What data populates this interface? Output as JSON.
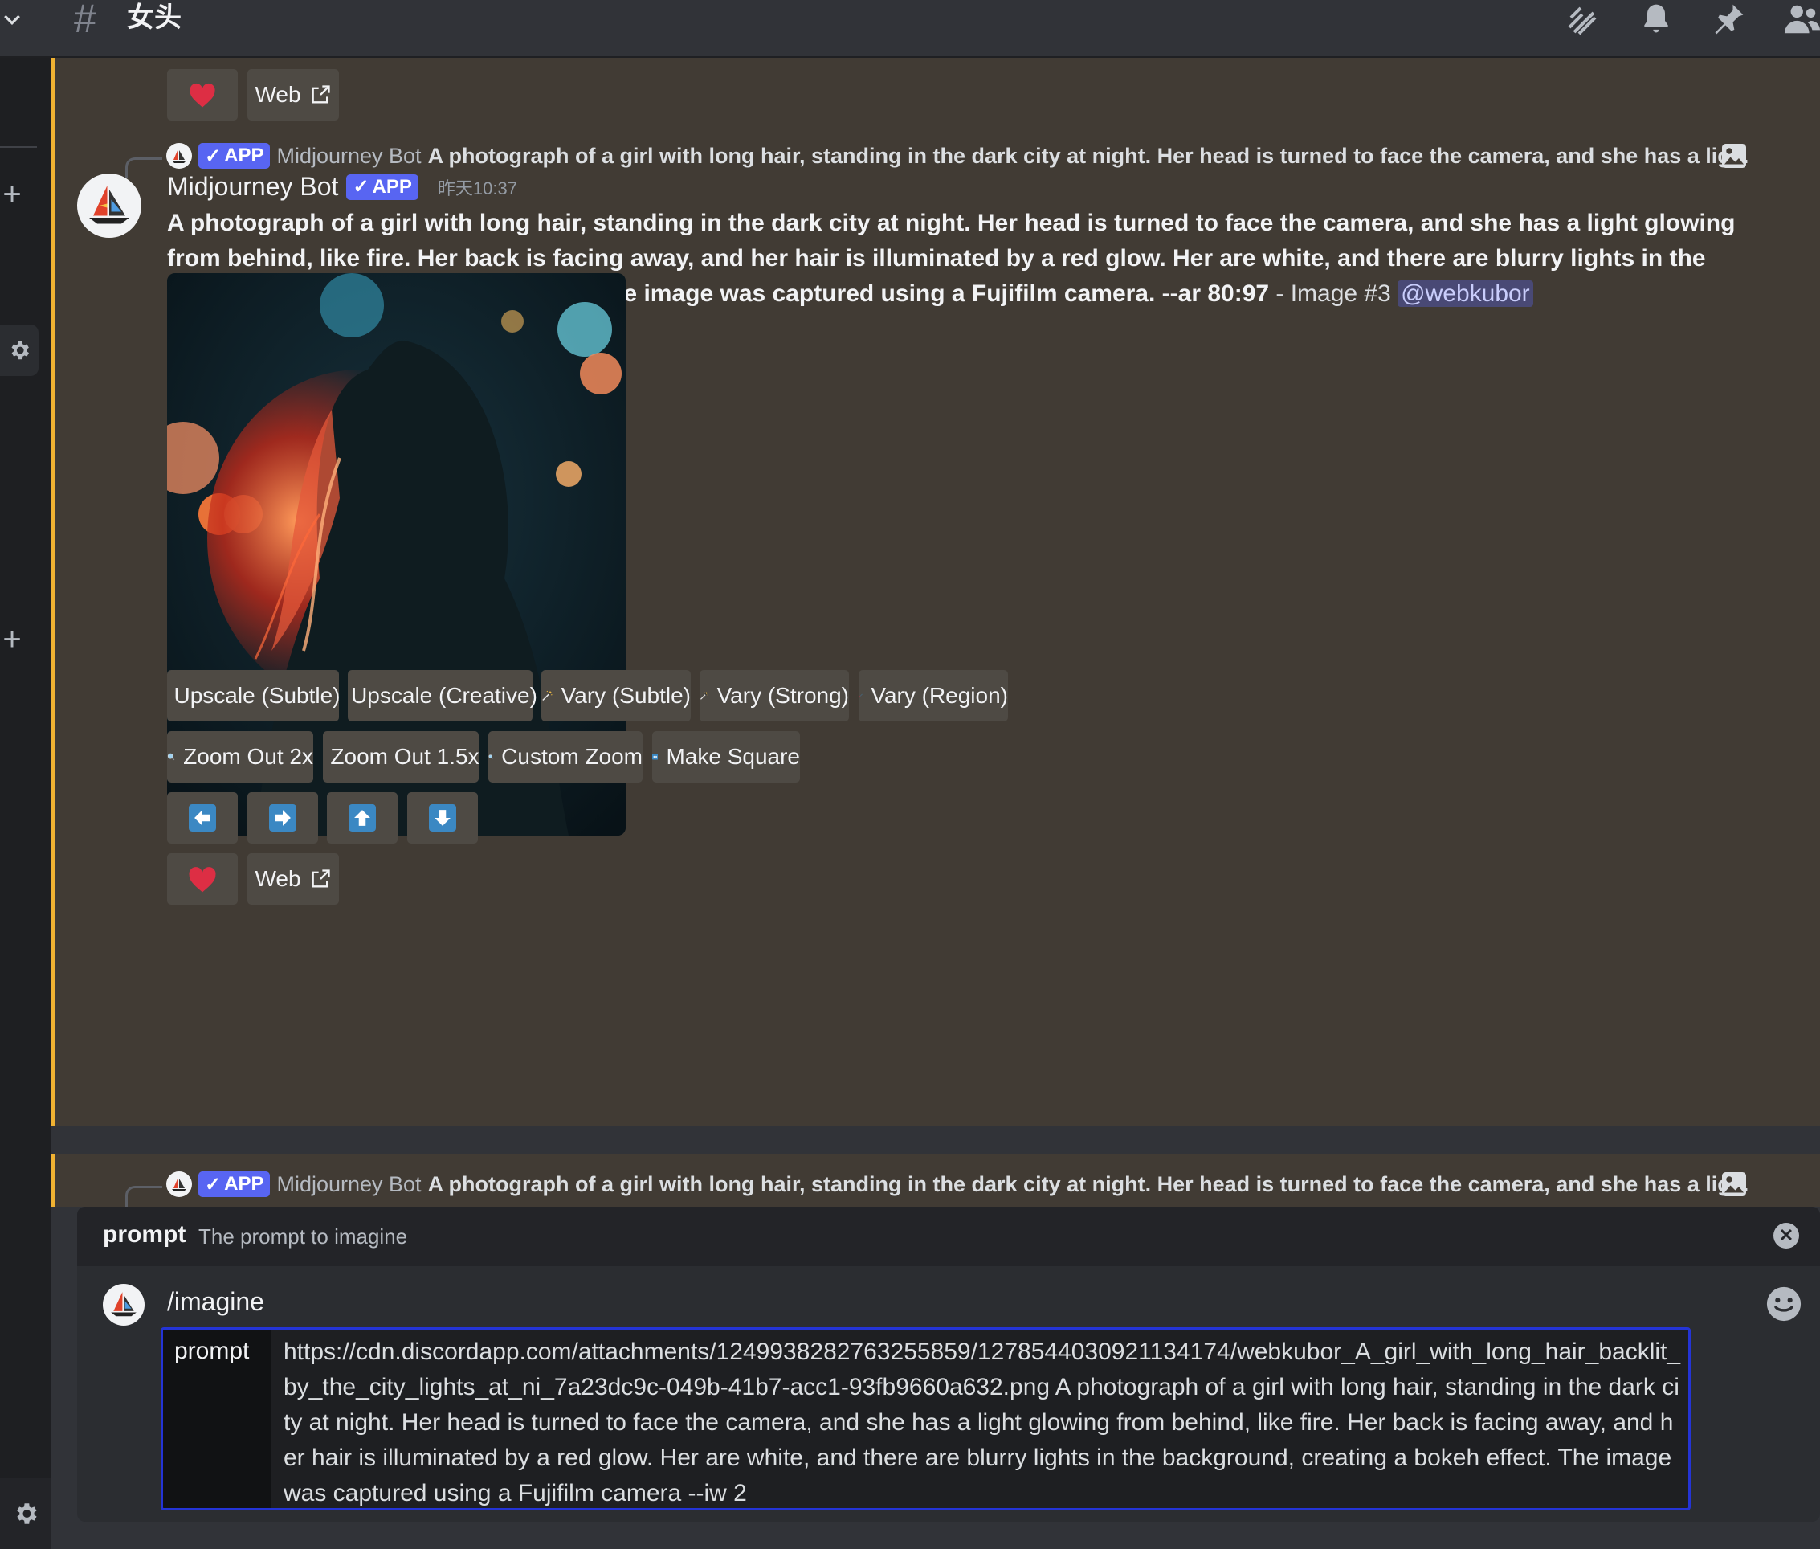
{
  "channel": {
    "name": "女头"
  },
  "bot": {
    "name": "Midjourney Bot",
    "tag": "APP",
    "timestamp": "昨天10:37"
  },
  "prev_message": {
    "buttons": {
      "web": "Web"
    }
  },
  "main_message": {
    "reply_preview": "A photograph of a girl with long hair, standing in the dark city at night. Her head is turned to face the camera, and she has a lig...",
    "prompt_text": "A photograph of a girl with long hair, standing in the dark city at night. Her head is turned to face the camera, and she has a light glowing from behind, like fire. Her back is facing away, and her hair is illuminated by a red glow. Her are white, and there are blurry lights in the background, creating a bokeh effect. The image was captured using a Fujifilm camera. --ar 80:97",
    "suffix": " - Image #3 ",
    "mention": "@webkubor",
    "buttons": {
      "upscale_subtle": "Upscale (Subtle)",
      "upscale_creative": "Upscale (Creative)",
      "vary_subtle": "Vary (Subtle)",
      "vary_strong": "Vary (Strong)",
      "vary_region": "Vary (Region)",
      "zoom_2x": "Zoom Out 2x",
      "zoom_15x": "Zoom Out 1.5x",
      "custom_zoom": "Custom Zoom",
      "make_square": "Make Square",
      "web": "Web"
    }
  },
  "next_message": {
    "reply_preview": "A photograph of a girl with long hair, standing in the dark city at night. Her head is turned to face the camera, and she has a lig..."
  },
  "command": {
    "option_name": "prompt",
    "option_desc": "The prompt to imagine",
    "command_name": "/imagine",
    "field_label": "prompt",
    "field_value": "https://cdn.discordapp.com/attachments/1249938282763255859/1278544030921134174/webkubor_A_girl_with_long_hair_backlit_by_the_city_lights_at_ni_7a23dc9c-049b-41b7-acc1-93fb9660a632.png    A photograph of a girl with long hair, standing in the dark city at night. Her head is turned to face the camera, and she has a light glowing from behind, like fire. Her back is facing away, and her hair is illuminated by a red glow. Her are white, and there are blurry lights in the background, creating a bokeh effect. The image was captured using a Fujifilm camera --iw 2"
  },
  "colors": {
    "accent_bar": "#f0b232",
    "app_tag": "#5865f2",
    "highlight_bg": "#413b34",
    "arrow_button": "#3b88c3"
  },
  "icons": [
    "hash-icon",
    "threads-icon",
    "bell-icon",
    "pin-icon",
    "members-icon",
    "gear-icon",
    "plus-icon",
    "image-icon",
    "heart-icon",
    "external-link-icon",
    "expand-icon",
    "magic-wand-icon",
    "paintbrush-icon",
    "magnifier-icon",
    "arrow-left-icon",
    "arrow-right-icon",
    "arrow-up-icon",
    "arrow-down-icon",
    "close-icon",
    "smile-icon",
    "checkmark-icon"
  ]
}
